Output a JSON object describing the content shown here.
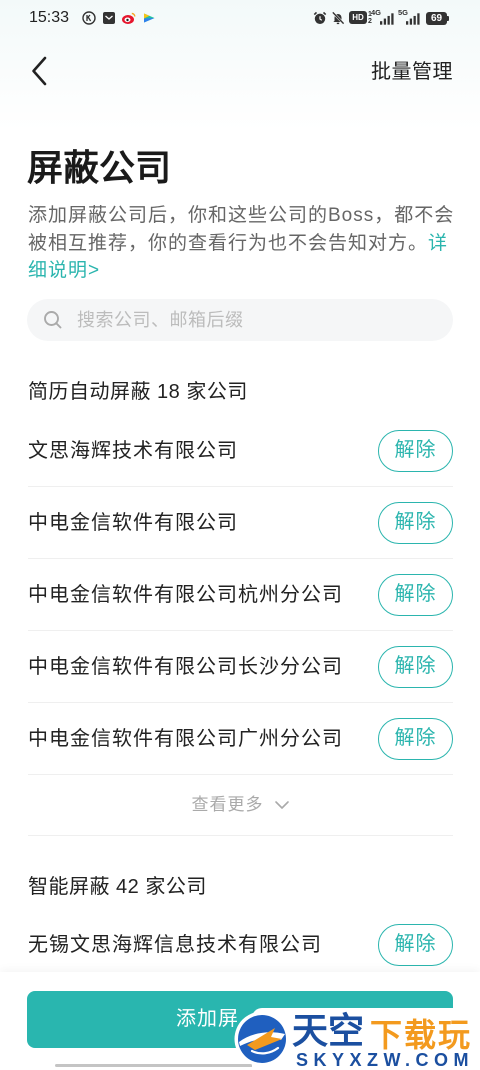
{
  "status_bar": {
    "time": "15:33",
    "left_icons": [
      "k-circle-icon",
      "mail-icon",
      "weibo-icon",
      "app-icon"
    ],
    "right_icons": [
      "alarm-icon",
      "bell-off-icon",
      "signal-icon",
      "battery-icon"
    ],
    "hd_label": "HD",
    "sim_1": "1",
    "sim_2": "2",
    "network_1": "4G",
    "network_2": "5G",
    "battery": "69"
  },
  "header": {
    "back_icon": "chevron-left-icon",
    "action_label": "批量管理"
  },
  "page": {
    "title": "屏蔽公司",
    "description": "添加屏蔽公司后，你和这些公司的Boss，都不会被相互推荐，你的查看行为也不会告知对方。",
    "detail_link": "详细说明>"
  },
  "search": {
    "icon": "search-icon",
    "placeholder": "搜索公司、邮箱后缀"
  },
  "sections": [
    {
      "heading": "简历自动屏蔽 18 家公司",
      "companies": [
        {
          "name": "文思海辉技术有限公司",
          "action": "解除"
        },
        {
          "name": "中电金信软件有限公司",
          "action": "解除"
        },
        {
          "name": "中电金信软件有限公司杭州分公司",
          "action": "解除"
        },
        {
          "name": "中电金信软件有限公司长沙分公司",
          "action": "解除"
        },
        {
          "name": "中电金信软件有限公司广州分公司",
          "action": "解除"
        }
      ],
      "more_label": "查看更多",
      "more_icon": "chevron-down-icon"
    },
    {
      "heading": "智能屏蔽 42 家公司",
      "companies": [
        {
          "name": "无锡文思海辉信息技术有限公司",
          "action": "解除"
        }
      ]
    }
  ],
  "footer": {
    "add_button_label": "添加屏"
  },
  "watermark": {
    "brand_blue": "天空",
    "brand_orange": "下载玩",
    "domain": "SKYXZW.COM"
  },
  "colors": {
    "accent": "#2bb5ae",
    "button_fill": "#29b6af",
    "text_primary": "#222222",
    "text_secondary": "#666666",
    "placeholder": "#bcbcbc",
    "divider": "#efefef",
    "search_bg": "#f5f6f7",
    "watermark_blue": "#1b4fa0",
    "watermark_orange": "#f39a1e"
  }
}
